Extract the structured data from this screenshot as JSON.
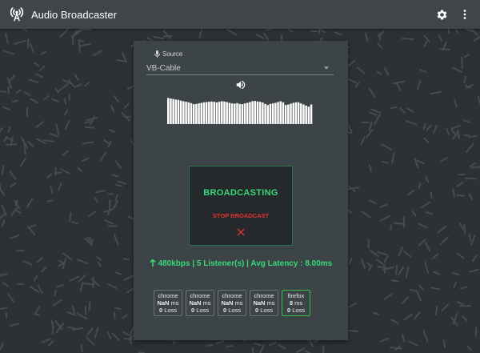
{
  "app": {
    "title": "Audio Broadcaster"
  },
  "toolbar": {
    "icons": [
      "antenna-icon",
      "gear-icon",
      "more-vert-icon"
    ]
  },
  "source": {
    "label": "Source",
    "selected": "VB-Cable"
  },
  "meter": {
    "levels": [
      0.96,
      0.94,
      0.92,
      0.9,
      0.89,
      0.86,
      0.84,
      0.82,
      0.8,
      0.77,
      0.73,
      0.74,
      0.76,
      0.78,
      0.8,
      0.81,
      0.82,
      0.83,
      0.82,
      0.8,
      0.82,
      0.84,
      0.83,
      0.81,
      0.78,
      0.76,
      0.75,
      0.77,
      0.74,
      0.73,
      0.76,
      0.78,
      0.81,
      0.84,
      0.85,
      0.83,
      0.82,
      0.79,
      0.74,
      0.7,
      0.74,
      0.76,
      0.78,
      0.81,
      0.84,
      0.8,
      0.7,
      0.72,
      0.75,
      0.78,
      0.8,
      0.8,
      0.76,
      0.72,
      0.68,
      0.64,
      0.72
    ]
  },
  "broadcast": {
    "status": "BROADCASTING",
    "stop_label": "STOP BROADCAST",
    "accent": "#36d977",
    "stop_color": "#e0332f"
  },
  "stats": {
    "text": "480kbps | 5 Listener(s) | Avg Latency : 8.00ms"
  },
  "clients": [
    {
      "browser": "chrome",
      "latency": "NaN",
      "unit": "ms",
      "loss": "0",
      "loss_label": "Loss"
    },
    {
      "browser": "chrome",
      "latency": "NaN",
      "unit": "ms",
      "loss": "0",
      "loss_label": "Loss"
    },
    {
      "browser": "chrome",
      "latency": "NaN",
      "unit": "ms",
      "loss": "0",
      "loss_label": "Loss"
    },
    {
      "browser": "chrome",
      "latency": "NaN",
      "unit": "ms",
      "loss": "0",
      "loss_label": "Loss"
    },
    {
      "browser": "firefox",
      "latency": "8",
      "unit": "ms",
      "loss": "0",
      "loss_label": "Loss"
    }
  ]
}
